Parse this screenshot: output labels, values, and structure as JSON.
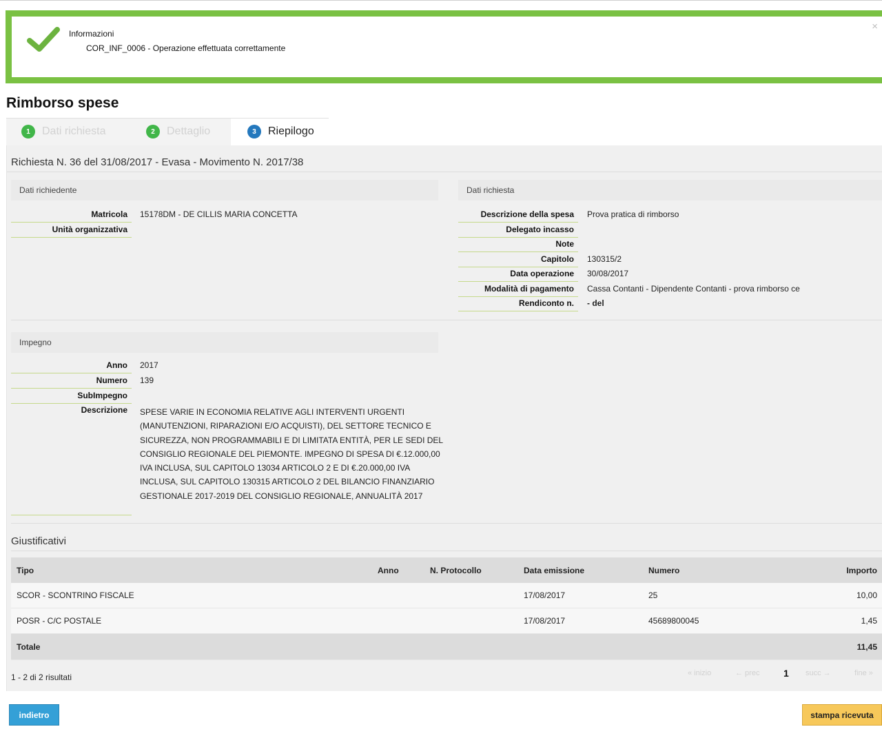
{
  "message": {
    "title": "Informazioni",
    "text": "COR_INF_0006 - Operazione effettuata correttamente",
    "close": "×"
  },
  "page_title": "Rimborso spese",
  "steps": [
    {
      "num": "1",
      "label": "Dati richiesta"
    },
    {
      "num": "2",
      "label": "Dettaglio"
    },
    {
      "num": "3",
      "label": "Riepilogo"
    }
  ],
  "request_title": "Richiesta N. 36 del 31/08/2017 - Evasa - Movimento N. 2017/38",
  "richiedente": {
    "heading": "Dati richiedente",
    "fields": [
      {
        "label": "Matricola",
        "value": "15178DM - DE CILLIS MARIA CONCETTA"
      },
      {
        "label": "Unità organizzativa",
        "value": ""
      }
    ]
  },
  "richiesta": {
    "heading": "Dati richiesta",
    "fields": [
      {
        "label": "Descrizione della spesa",
        "value": "Prova pratica di rimborso"
      },
      {
        "label": "Delegato incasso",
        "value": ""
      },
      {
        "label": "Note",
        "value": ""
      },
      {
        "label": "Capitolo",
        "value": "130315/2"
      },
      {
        "label": "Data operazione",
        "value": "30/08/2017"
      },
      {
        "label": "Modalità di pagamento",
        "value": "Cassa Contanti - Dipendente Contanti - prova rimborso ce"
      },
      {
        "label": "Rendiconto n.",
        "value": "- del"
      }
    ]
  },
  "impegno": {
    "heading": "Impegno",
    "fields": [
      {
        "label": "Anno",
        "value": "2017"
      },
      {
        "label": "Numero",
        "value": "139"
      },
      {
        "label": "SubImpegno",
        "value": ""
      },
      {
        "label": "Descrizione",
        "value": ""
      }
    ],
    "descrizione": "SPESE VARIE IN ECONOMIA RELATIVE AGLI INTERVENTI URGENTI (MANUTENZIONI, RIPARAZIONI E/O ACQUISTI), DEL SETTORE TECNICO E SICUREZZA, NON PROGRAMMABILI E DI LIMITATA ENTITÀ, PER LE SEDI DEL CONSIGLIO REGIONALE DEL PIEMONTE. IMPEGNO DI SPESA DI €.12.000,00 IVA INCLUSA, SUL CAPITOLO 13034 ARTICOLO 2 E DI €.20.000,00 IVA INCLUSA, SUL CAPITOLO 130315 ARTICOLO 2 DEL BILANCIO FINANZIARIO GESTIONALE 2017-2019 DEL CONSIGLIO REGIONALE, ANNUALITÀ 2017"
  },
  "giustificativi": {
    "heading": "Giustificativi",
    "columns": [
      "Tipo",
      "Anno",
      "N. Protocollo",
      "Data emissione",
      "Numero",
      "Importo"
    ],
    "rows": [
      {
        "tipo": "SCOR - SCONTRINO FISCALE",
        "anno": "",
        "protocollo": "",
        "data": "17/08/2017",
        "numero": "25",
        "importo": "10,00"
      },
      {
        "tipo": "POSR - C/C POSTALE",
        "anno": "",
        "protocollo": "",
        "data": "17/08/2017",
        "numero": "45689800045",
        "importo": "1,45"
      }
    ],
    "total_label": "Totale",
    "total_value": "11,45"
  },
  "pagination": {
    "results": "1 - 2 di 2 risultati",
    "first": "« inizio",
    "prev": "← prec",
    "current": "1",
    "next": "succ →",
    "last": "fine »"
  },
  "buttons": {
    "back": "indietro",
    "print": "stampa ricevuta"
  },
  "colors": {
    "success": "#7ac143",
    "step_done": "#41b649",
    "step_current": "#2478bd",
    "btn_back": "#34a0d7",
    "btn_print": "#f7c85a"
  }
}
